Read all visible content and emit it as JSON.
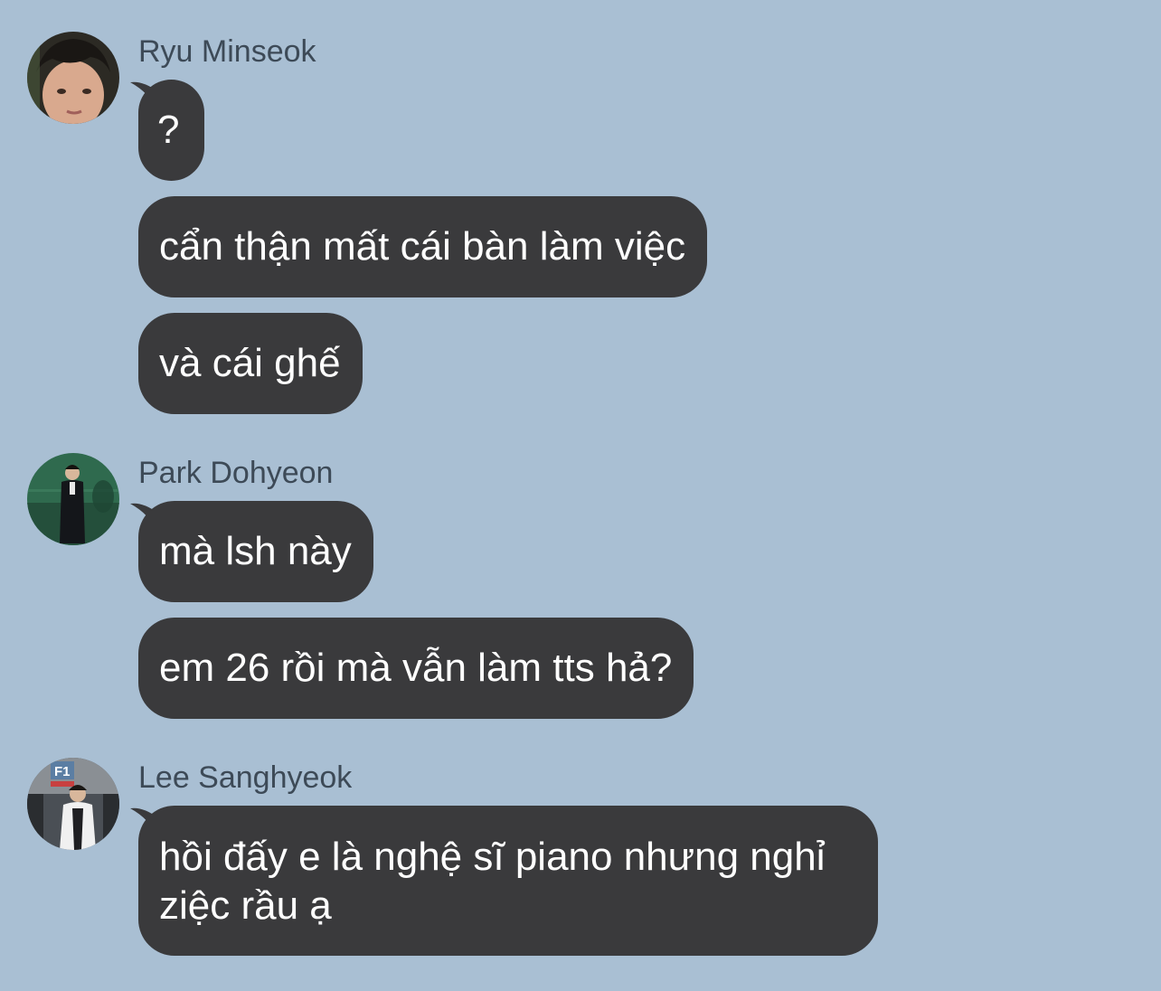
{
  "colors": {
    "background": "#a9bfd3",
    "bubble": "#3a3a3c",
    "bubble_text": "#ffffff",
    "sender_text": "#3d4a57"
  },
  "messages": [
    {
      "sender": "Ryu Minseok",
      "avatar": "avatar-photo",
      "bubbles": [
        "?",
        "cẩn thận mất cái bàn làm việc",
        "và cái ghế"
      ]
    },
    {
      "sender": "Park Dohyeon",
      "avatar": "avatar-photo",
      "bubbles": [
        "mà lsh này",
        "em 26 rồi mà vẫn làm tts hả?"
      ]
    },
    {
      "sender": "Lee Sanghyeok",
      "avatar": "avatar-photo",
      "avatar_badge": "F1",
      "bubbles": [
        "hồi đấy e là nghệ sĩ piano nhưng nghỉ ziệc rầu ạ"
      ]
    }
  ]
}
